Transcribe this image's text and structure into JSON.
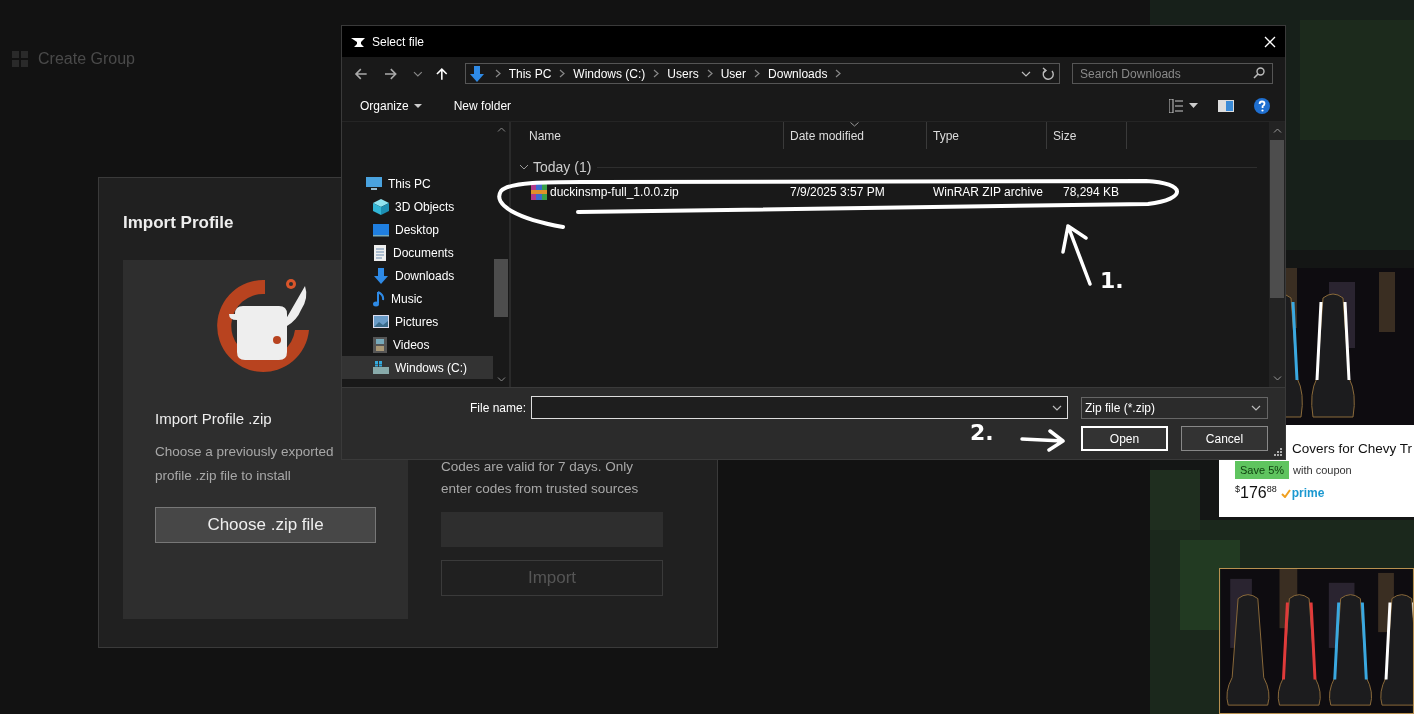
{
  "background_page": {
    "sidebar_item": {
      "label": "Create Group"
    }
  },
  "import_profile": {
    "title": "Import Profile",
    "file_card": {
      "title": "Import Profile .zip",
      "description": "Choose a previously exported profile .zip file to install",
      "button": "Choose .zip file"
    },
    "code_card": {
      "description": "Codes are valid for 7 days. Only enter codes from trusted sources",
      "import_button": {
        "label": "Import",
        "disabled": true
      }
    }
  },
  "ads": [
    {
      "kind": "product",
      "title": "Covers for Chevy Tr",
      "badge": "Save 5%",
      "badge_note": "with coupon",
      "price_currency": "$",
      "price_whole": "176",
      "price_fraction": "88",
      "delivery": "prime"
    },
    {
      "kind": "picture"
    }
  ],
  "file_dialog": {
    "title": "Select file",
    "breadcrumb": [
      "This PC",
      "Windows (C:)",
      "Users",
      "User",
      "Downloads"
    ],
    "search": {
      "placeholder": "Search Downloads"
    },
    "commands": [
      {
        "label": "Organize",
        "menu": true
      },
      {
        "label": "New folder",
        "menu": false
      }
    ],
    "nav_pane": [
      {
        "label": "This PC",
        "kind": "pc",
        "selected": false,
        "children": [
          {
            "label": "3D Objects",
            "kind": "objects",
            "selected": false
          },
          {
            "label": "Desktop",
            "kind": "desktop",
            "selected": false
          },
          {
            "label": "Documents",
            "kind": "documents",
            "selected": false
          },
          {
            "label": "Downloads",
            "kind": "downloads",
            "selected": false
          },
          {
            "label": "Music",
            "kind": "music",
            "selected": false
          },
          {
            "label": "Pictures",
            "kind": "pictures",
            "selected": false
          },
          {
            "label": "Videos",
            "kind": "videos",
            "selected": false
          },
          {
            "label": "Windows (C:)",
            "kind": "drive",
            "selected": true
          }
        ]
      }
    ],
    "columns": [
      {
        "label": "Name",
        "sorted": false
      },
      {
        "label": "Date modified",
        "sorted": true
      },
      {
        "label": "Type",
        "sorted": false
      },
      {
        "label": "Size",
        "sorted": false
      }
    ],
    "groups": [
      {
        "label": "Today (1)",
        "expanded": true,
        "files": [
          {
            "name": "duckinsmp-full_1.0.0.zip",
            "date_modified": "7/9/2025 3:57 PM",
            "type": "WinRAR ZIP archive",
            "size": "78,294 KB",
            "selected": false
          }
        ]
      }
    ],
    "file_name_label": "File name:",
    "file_type": "Zip file (*.zip)",
    "buttons": [
      {
        "label": "Open",
        "default": true
      },
      {
        "label": "Cancel",
        "default": false
      }
    ]
  },
  "annotations": {
    "step_labels": [
      "1.",
      "2."
    ]
  }
}
